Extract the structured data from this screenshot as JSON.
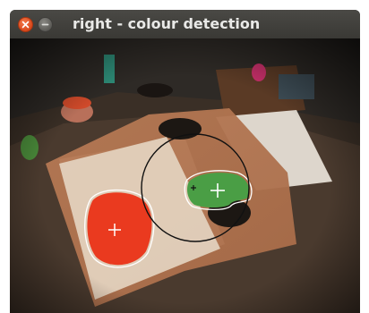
{
  "window": {
    "title": "right - colour detection"
  },
  "icons": {
    "close": "close-icon",
    "minimize": "minimize-icon"
  },
  "camera_view": {
    "blobs": [
      {
        "name": "red-blob",
        "color": "#ea3a1f"
      },
      {
        "name": "green-blob",
        "color": "#4a9e45"
      }
    ],
    "search_circle_color": "#111111",
    "crosshair_color": "#ffffff"
  }
}
